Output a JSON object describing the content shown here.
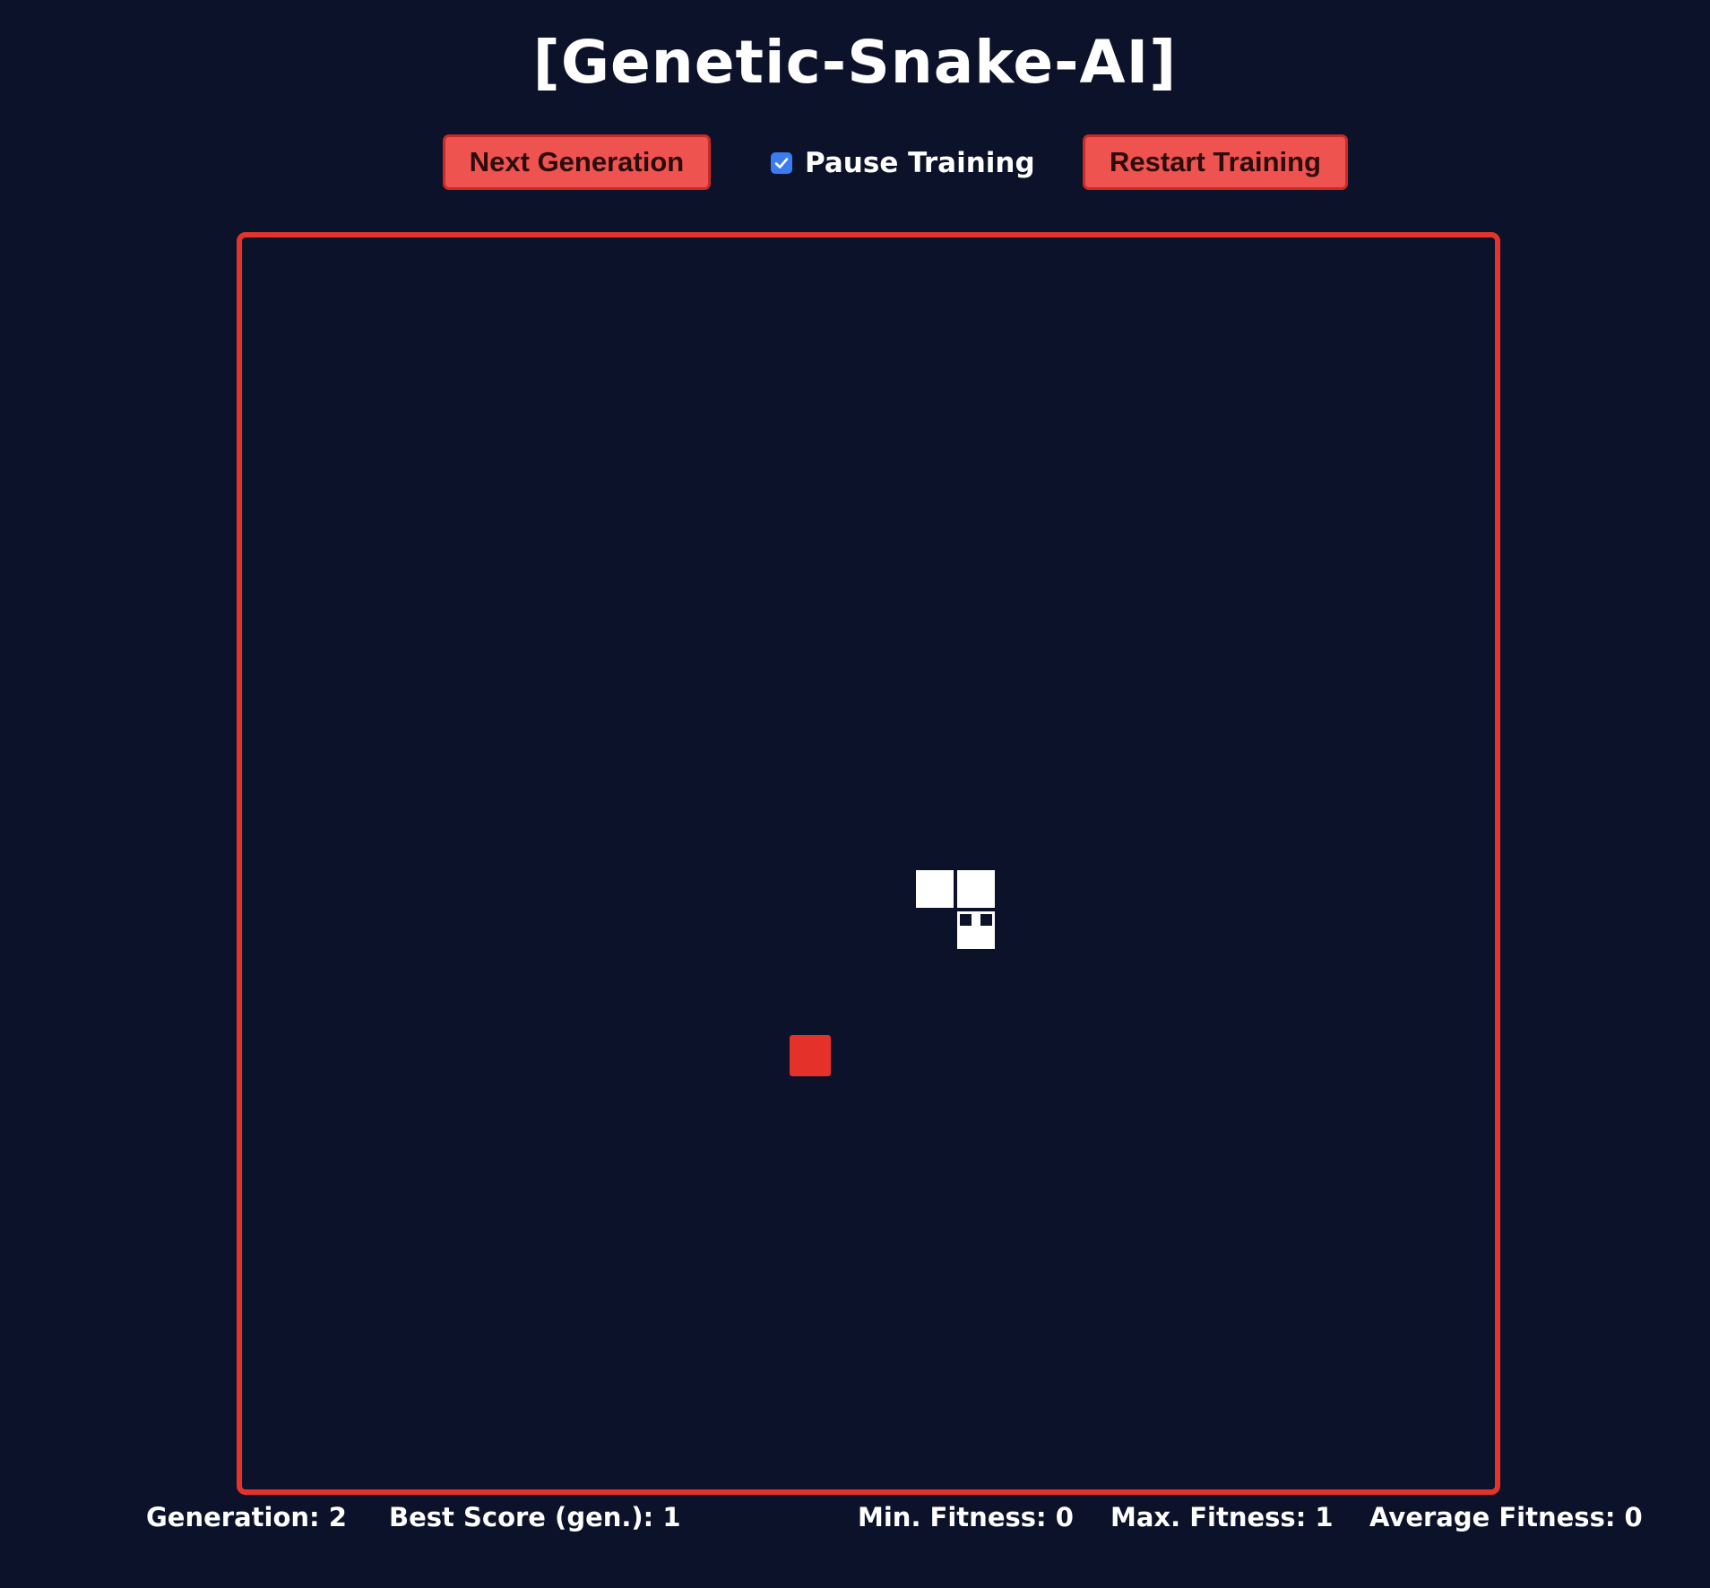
{
  "title": "[Genetic-Snake-AI]",
  "controls": {
    "next_generation_label": "Next Generation",
    "pause_label": "Pause Training",
    "pause_checked": true,
    "restart_label": "Restart Training"
  },
  "colors": {
    "background": "#0c1229",
    "accent": "#e0342c",
    "button": "#ee5350",
    "checkbox": "#3b7cf0",
    "snake": "#ffffff",
    "food": "#e4322b"
  },
  "stats": {
    "generation": "Generation: 2",
    "best_score": "Best Score (gen.): 1",
    "min_fitness": "Min. Fitness: 0",
    "max_fitness": "Max. Fitness: 1",
    "average_fitness": "Average Fitness: 0"
  }
}
